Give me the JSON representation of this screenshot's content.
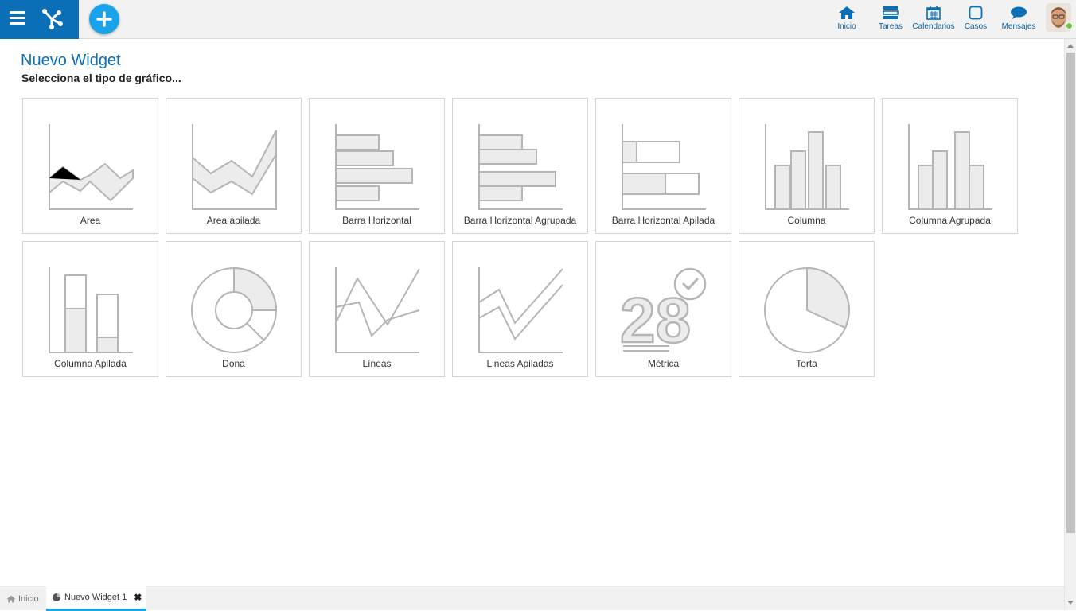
{
  "header": {
    "nav": [
      {
        "label": "Inicio",
        "icon": "home-icon"
      },
      {
        "label": "Tareas",
        "icon": "tasks-icon"
      },
      {
        "label": "Calendarios",
        "icon": "calendar-icon"
      },
      {
        "label": "Casos",
        "icon": "cases-icon"
      },
      {
        "label": "Mensajes",
        "icon": "messages-icon"
      }
    ]
  },
  "page": {
    "title": "Nuevo Widget",
    "subtitle": "Selecciona el tipo de gráfico..."
  },
  "widgets": [
    {
      "label": "Area"
    },
    {
      "label": "Area apilada"
    },
    {
      "label": "Barra Horizontal"
    },
    {
      "label": "Barra Horizontal Agrupada"
    },
    {
      "label": "Barra Horizontal Apilada"
    },
    {
      "label": "Columna"
    },
    {
      "label": "Columna Agrupada"
    },
    {
      "label": "Columna Apilada"
    },
    {
      "label": "Dona"
    },
    {
      "label": "Líneas"
    },
    {
      "label": "Lineas Apiladas"
    },
    {
      "label": "Métrica",
      "number": "28"
    },
    {
      "label": "Torta"
    }
  ],
  "tabs": [
    {
      "label": "Inicio",
      "icon": "home-icon"
    },
    {
      "label": "Nuevo Widget 1",
      "icon": "pie-chart-icon"
    }
  ],
  "colors": {
    "brand": "#0b6fb8",
    "accent": "#1aa3e8",
    "online": "#76c043"
  }
}
